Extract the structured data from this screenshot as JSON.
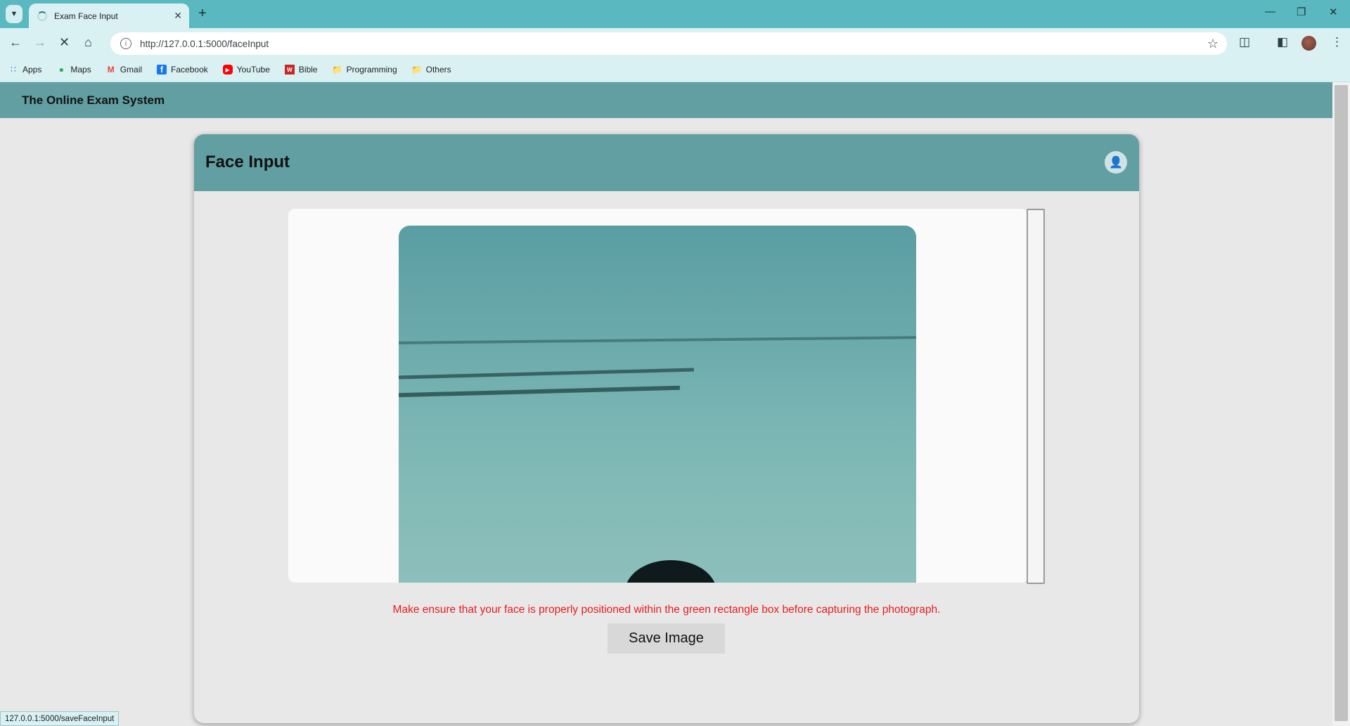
{
  "browser": {
    "tab_title": "Exam Face Input",
    "url": "http://127.0.0.1:5000/faceInput",
    "bookmarks": [
      {
        "label": "Apps",
        "icon": "apps-grid-icon"
      },
      {
        "label": "Maps",
        "icon": "maps-pin-icon"
      },
      {
        "label": "Gmail",
        "icon": "gmail-icon"
      },
      {
        "label": "Facebook",
        "icon": "facebook-icon"
      },
      {
        "label": "YouTube",
        "icon": "youtube-icon"
      },
      {
        "label": "Bible",
        "icon": "bible-icon"
      },
      {
        "label": "Programming",
        "icon": "folder-icon"
      },
      {
        "label": "Others",
        "icon": "folder-icon"
      }
    ],
    "status_url": "127.0.0.1:5000/saveFaceInput"
  },
  "app": {
    "brand": "The Online Exam System"
  },
  "card": {
    "title": "Face Input",
    "instruction": "Make ensure that your face is properly positioned within the green rectangle box before capturing the photograph.",
    "save_label": "Save Image"
  },
  "colors": {
    "tabbar": "#5ab8c0",
    "toolbar": "#d9f1f3",
    "header": "#629fa2",
    "instruction": "#e81c1c"
  }
}
